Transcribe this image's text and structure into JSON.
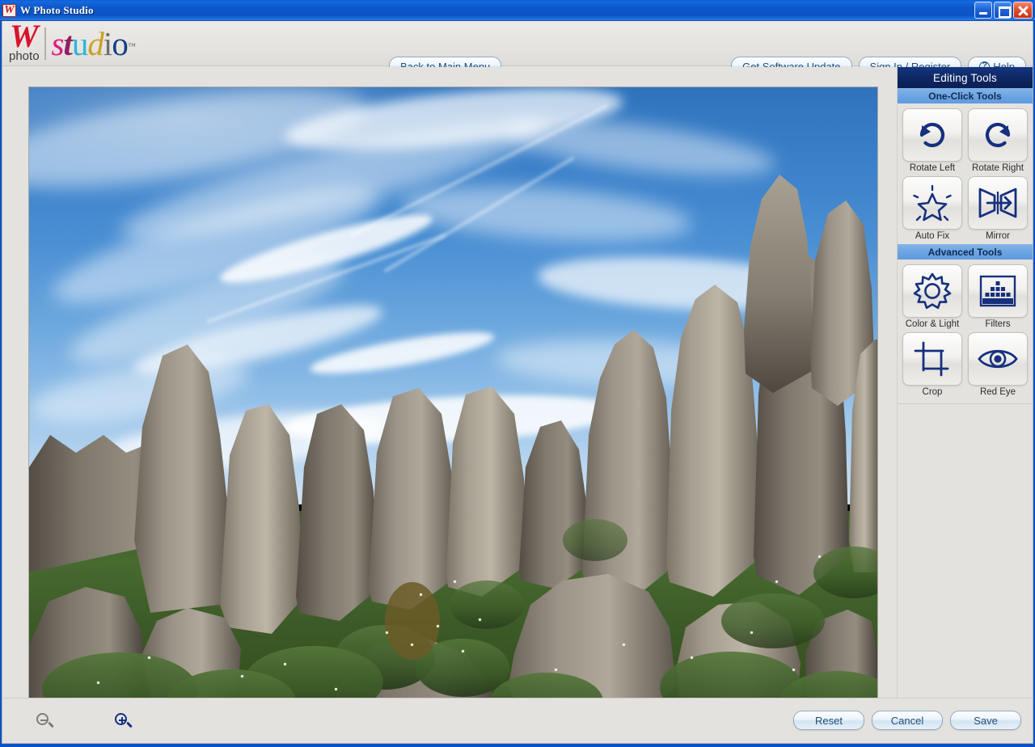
{
  "window": {
    "title": "W Photo Studio",
    "icon": "app-logo-icon",
    "controls": {
      "minimize": "Minimize",
      "maximize": "Restore",
      "close": "Close"
    }
  },
  "header": {
    "logo": {
      "brand_mark": "W",
      "brand_sub": "photo",
      "product": "studio",
      "trademark": "™",
      "letters": [
        "s",
        "t",
        "u",
        "d",
        "i",
        "o"
      ],
      "letter_colors": [
        "#e5177f",
        "#8e2060",
        "#2fb6d8",
        "#c9a227",
        "#6f6f6f",
        "#123f86"
      ],
      "brand_color": "#d9122b"
    },
    "back_to_main_menu": "Back to Main Menu",
    "get_software_update": "Get Software Update",
    "sign_in_register": "Sign In / Register",
    "help": "Help"
  },
  "sidebar": {
    "title": "Editing Tools",
    "sections": [
      {
        "heading": "One-Click Tools",
        "tools": [
          {
            "label": "Rotate Left",
            "icon": "rotate-left-icon"
          },
          {
            "label": "Rotate Right",
            "icon": "rotate-right-icon"
          },
          {
            "label": "Auto Fix",
            "icon": "auto-fix-star-icon"
          },
          {
            "label": "Mirror",
            "icon": "mirror-icon"
          }
        ]
      },
      {
        "heading": "Advanced Tools",
        "tools": [
          {
            "label": "Color & Light",
            "icon": "sun-burst-icon"
          },
          {
            "label": "Filters",
            "icon": "histogram-icon"
          },
          {
            "label": "Crop",
            "icon": "crop-icon"
          },
          {
            "label": "Red Eye",
            "icon": "eye-icon"
          }
        ]
      }
    ]
  },
  "canvas": {
    "photo_description": "Granite rock outcrop with green shrubs and white wildflowers under a blue sky with wispy cirrus clouds"
  },
  "bottombar": {
    "zoom_out": "Zoom Out",
    "zoom_in": "Zoom In",
    "reset": "Reset",
    "cancel": "Cancel",
    "save": "Save"
  },
  "colors": {
    "titlebar_blue": "#0c57c9",
    "panel_header_navy": "#0e2763",
    "section_blue": "#6ba4e2",
    "icon_blue": "#16307e",
    "button_text": "#1f4e79",
    "chrome_gray": "#e4e2df"
  }
}
